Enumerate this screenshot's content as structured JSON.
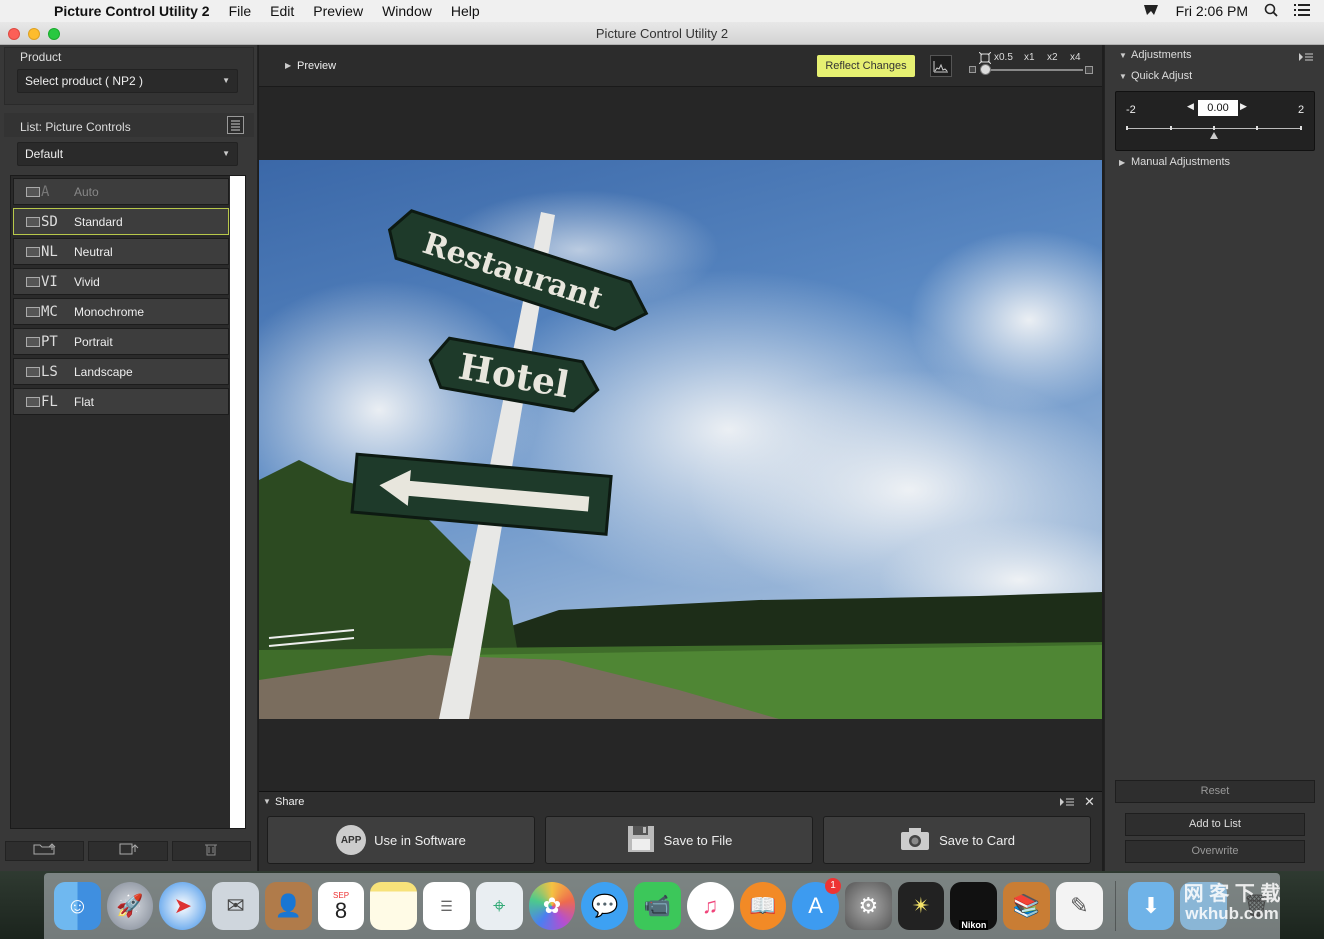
{
  "menubar": {
    "app": "Picture Control Utility 2",
    "items": [
      "File",
      "Edit",
      "Preview",
      "Window",
      "Help"
    ],
    "clock": "Fri 2:06 PM"
  },
  "window": {
    "title": "Picture Control Utility 2"
  },
  "left": {
    "product_label": "Product",
    "product_select": "Select product ( NP2 )",
    "list_label": "List: Picture Controls",
    "list_select": "Default",
    "items": [
      {
        "code": "A",
        "label": "Auto"
      },
      {
        "code": "SD",
        "label": "Standard"
      },
      {
        "code": "NL",
        "label": "Neutral"
      },
      {
        "code": "VI",
        "label": "Vivid"
      },
      {
        "code": "MC",
        "label": "Monochrome"
      },
      {
        "code": "PT",
        "label": "Portrait"
      },
      {
        "code": "LS",
        "label": "Landscape"
      },
      {
        "code": "FL",
        "label": "Flat"
      }
    ]
  },
  "preview": {
    "label": "Preview",
    "reflect": "Reflect Changes",
    "zoom_labels": [
      "x0.5",
      "x1",
      "x2",
      "x4"
    ],
    "sign_restaurant": "Restaurant",
    "sign_hotel": "Hotel"
  },
  "share": {
    "label": "Share",
    "use_in_software": "Use in Software",
    "app_badge": "APP",
    "save_to_file": "Save to File",
    "save_to_card": "Save to Card"
  },
  "adjust": {
    "adjustments": "Adjustments",
    "quick_adjust": "Quick Adjust",
    "min": "-2",
    "max": "2",
    "value": "0.00",
    "manual": "Manual Adjustments",
    "reset": "Reset",
    "add_to_list": "Add to List",
    "overwrite": "Overwrite"
  },
  "dock": {
    "calendar_month": "SEP",
    "calendar_day": "8",
    "appstore_badge": "1",
    "nikon": "Nikon",
    "watermark_cn": "网 客 下 载",
    "watermark_url": "wkhub.com"
  }
}
